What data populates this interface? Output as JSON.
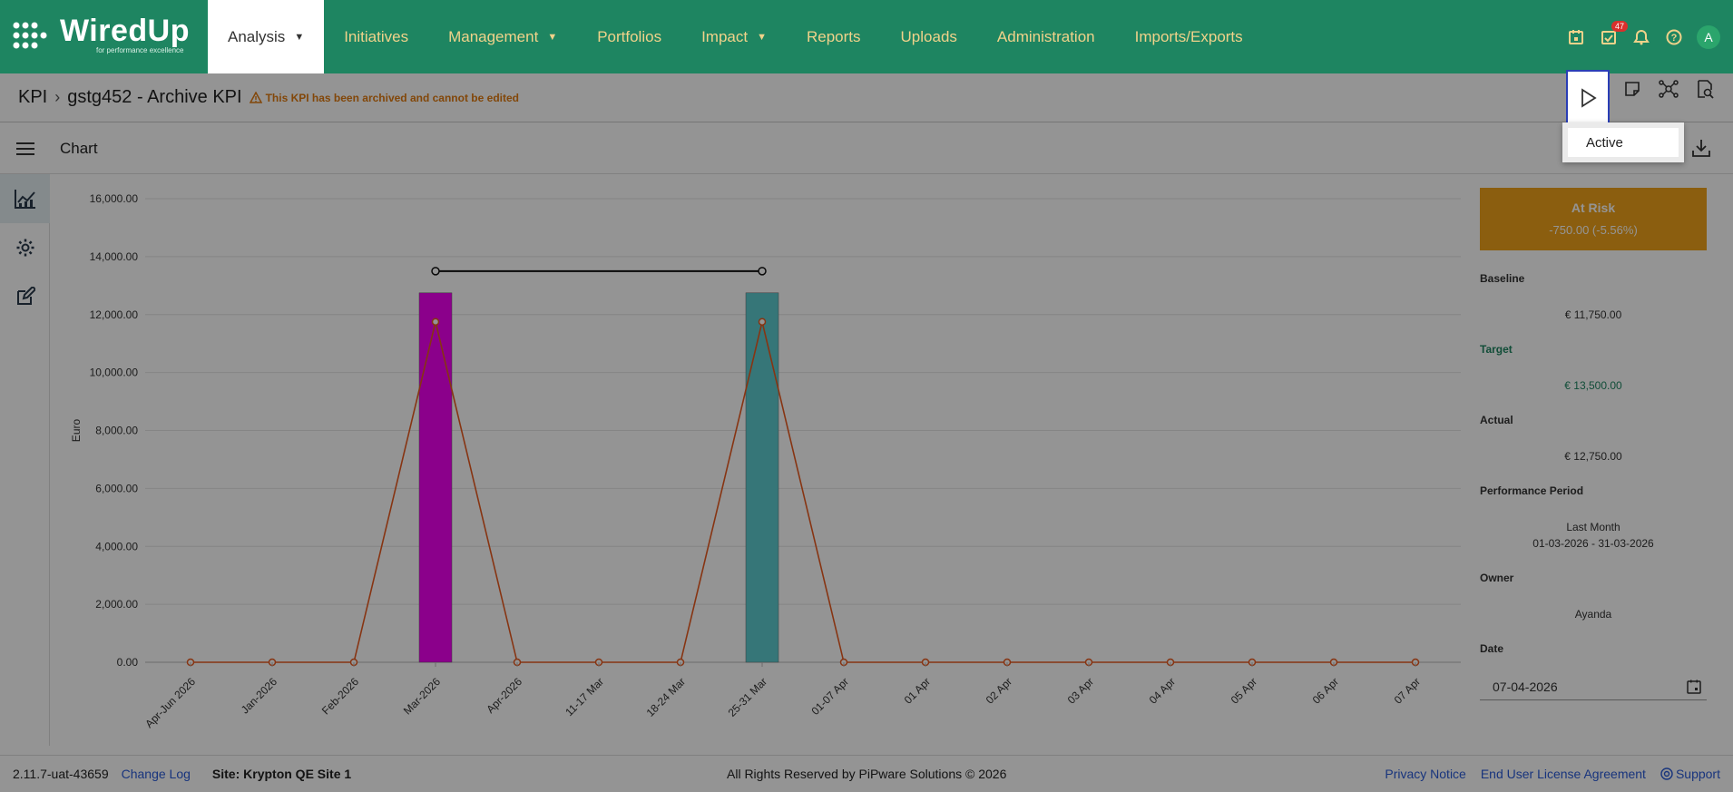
{
  "nav": {
    "brand": "WiredUp",
    "tagline": "for performance excellence",
    "items": [
      {
        "label": "Analysis",
        "caret": true,
        "active": true
      },
      {
        "label": "Initiatives",
        "caret": false
      },
      {
        "label": "Management",
        "caret": true
      },
      {
        "label": "Portfolios",
        "caret": false
      },
      {
        "label": "Impact",
        "caret": true
      },
      {
        "label": "Reports",
        "caret": false
      },
      {
        "label": "Uploads",
        "caret": false
      },
      {
        "label": "Administration",
        "caret": false
      },
      {
        "label": "Imports/Exports",
        "caret": false
      }
    ],
    "tasks_badge": "47",
    "avatar_letter": "A"
  },
  "breadcrumb": {
    "root": "KPI",
    "current": "gstg452 - Archive KPI",
    "warning": "This KPI has been archived and cannot be edited"
  },
  "status_menu": {
    "option": "Active"
  },
  "subbar": {
    "title": "Chart"
  },
  "chart_data": {
    "type": "bar",
    "ylabel": "Euro",
    "ylim": [
      0,
      16000
    ],
    "yticks": [
      "16,000.00",
      "14,000.00",
      "12,000.00",
      "10,000.00",
      "8,000.00",
      "6,000.00",
      "4,000.00",
      "2,000.00",
      "0.00"
    ],
    "categories": [
      "Apr-Jun 2026",
      "Jan-2026",
      "Feb-2026",
      "Mar-2026",
      "Apr-2026",
      "11-17 Mar",
      "18-24 Mar",
      "25-31 Mar",
      "01-07 Apr",
      "01 Apr",
      "02 Apr",
      "03 Apr",
      "04 Apr",
      "05 Apr",
      "06 Apr",
      "07 Apr"
    ],
    "bars": [
      {
        "category": "Mar-2026",
        "value": 12750,
        "color": "#f000f0"
      },
      {
        "category": "25-31 Mar",
        "value": 12750,
        "color": "#5ecbcf"
      }
    ],
    "line_values": [
      0,
      0,
      0,
      11750,
      0,
      0,
      0,
      11750,
      0,
      0,
      0,
      0,
      0,
      0,
      0,
      0
    ],
    "line_color": "#e85a1f",
    "target_segment": {
      "from": "Mar-2026",
      "to": "25-31 Mar",
      "value": 13500
    }
  },
  "panel": {
    "status": "At Risk",
    "variance": "-750.00 (-5.56%)",
    "baseline_label": "Baseline",
    "baseline_value": "€ 11,750.00",
    "target_label": "Target",
    "target_value": "€ 13,500.00",
    "actual_label": "Actual",
    "actual_value": "€ 12,750.00",
    "period_label": "Performance Period",
    "period_name": "Last Month",
    "period_range": "01-03-2026 - 31-03-2026",
    "owner_label": "Owner",
    "owner_value": "Ayanda",
    "date_label": "Date",
    "date_value": "07-04-2026"
  },
  "footer": {
    "version": "2.11.7-uat-43659",
    "changelog": "Change Log",
    "site": "Site: Krypton QE Site 1",
    "rights": "All Rights Reserved by PiPware Solutions © 2026",
    "privacy": "Privacy Notice",
    "eula": "End User License Agreement",
    "support": "Support"
  }
}
